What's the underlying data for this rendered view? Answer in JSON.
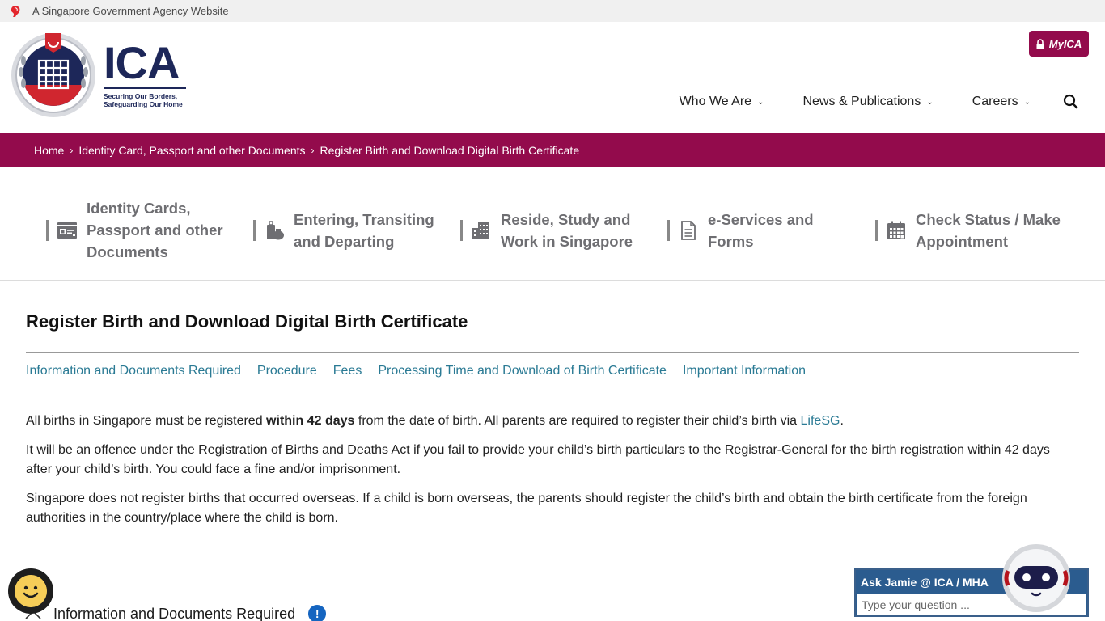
{
  "gov_banner": {
    "text": "A Singapore Government Agency Website",
    "icon": "lion-head-icon"
  },
  "header": {
    "logo": {
      "name": "ICA",
      "tagline_line1": "Securing Our Borders,",
      "tagline_line2": "Safeguarding Our Home"
    },
    "myica_button": {
      "label": "MyICA",
      "icon": "lock-icon"
    },
    "nav": [
      {
        "label": "Who We Are",
        "icon": "chevron-down-icon"
      },
      {
        "label": "News & Publications",
        "icon": "chevron-down-icon"
      },
      {
        "label": "Careers",
        "icon": "chevron-down-icon"
      }
    ],
    "search_icon": "search-icon"
  },
  "breadcrumb": {
    "items": [
      "Home",
      "Identity Card, Passport and other Documents",
      "Register Birth and Download Digital Birth Certificate"
    ],
    "separator": "›"
  },
  "category_nav": [
    {
      "line1": "Identity Cards,",
      "line2": "Passport and other",
      "line3": "Documents",
      "icon": "id-card-icon"
    },
    {
      "line1": "Entering, Transiting",
      "line2": "and Departing",
      "icon": "luggage-icon"
    },
    {
      "line1": "Reside, Study and",
      "line2": "Work in Singapore",
      "icon": "building-icon"
    },
    {
      "line1": "e-Services and",
      "line2": "Forms",
      "icon": "document-icon"
    },
    {
      "line1": "Check Status / Make",
      "line2": "Appointment",
      "icon": "calendar-icon"
    }
  ],
  "page": {
    "title": "Register Birth and Download Digital Birth Certificate",
    "anchors": [
      "Information and Documents Required",
      "Procedure",
      "Fees",
      "Processing Time and Download of Birth Certificate",
      "Important Information"
    ],
    "paragraph1": {
      "before": "All births in Singapore must be registered ",
      "bold": "within 42 days",
      "middle": " from the date of birth. All parents are required to register their child’s birth via ",
      "link": "LifeSG",
      "after": "."
    },
    "paragraph2": "It will be an offence under the Registration of Births and Deaths Act if you fail to provide your child’s birth particulars to the Registrar-General for the birth registration within 42 days after your child’s birth. You could face a fine and/or imprisonment.",
    "paragraph3": "Singapore does not register births that occurred overseas. If a child is born overseas, the parents should register the child’s birth and obtain the birth certificate from the foreign authorities in the country/place where the child is born.",
    "accordion": {
      "label": "Information and Documents Required",
      "info_badge": "!"
    }
  },
  "widgets": {
    "feedback_icon": "smiley-feedback-icon",
    "ask_jamie": {
      "title": "Ask Jamie @ ICA / MHA",
      "placeholder": "Type your question ..."
    }
  },
  "colors": {
    "brand": "#930b4c",
    "navy": "#1d2759",
    "link": "#2a7a94",
    "chat_blue": "#2b5c8f"
  }
}
